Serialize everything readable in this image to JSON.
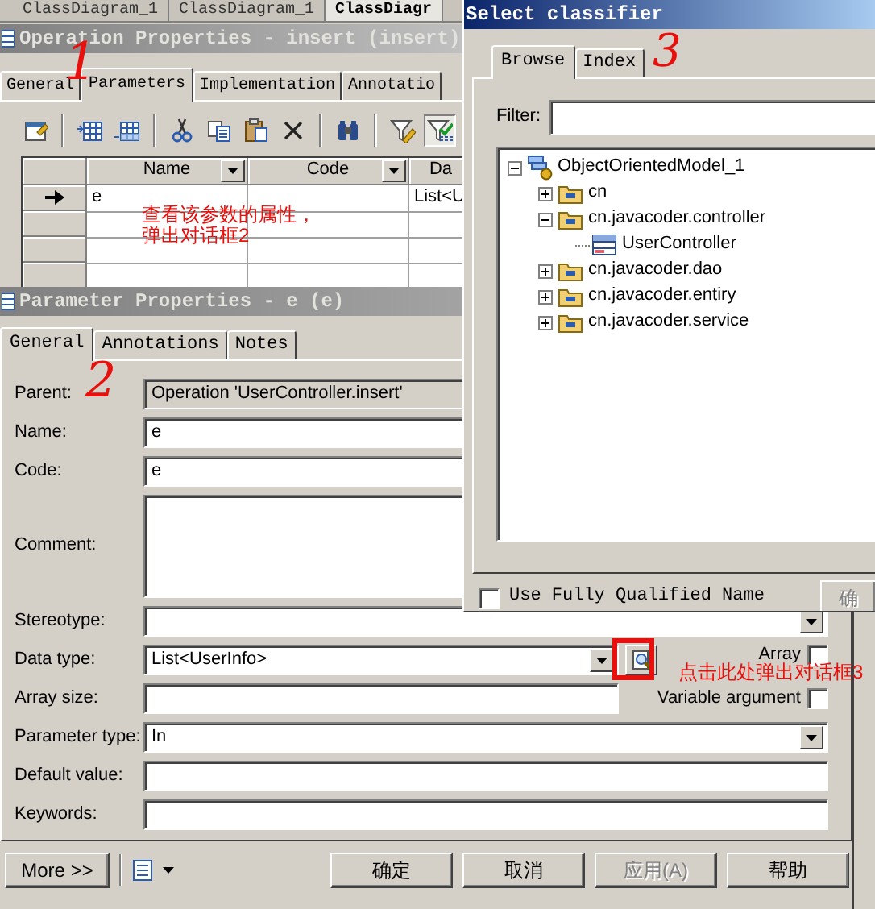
{
  "background_tabs": [
    {
      "label": "ClassDiagram_1",
      "selected": false
    },
    {
      "label": "ClassDiagram_1",
      "selected": false
    },
    {
      "label": "ClassDiagr",
      "selected": true
    }
  ],
  "operation_window": {
    "title": "Operation Properties - insert (insert)",
    "active": false,
    "tabs": [
      {
        "label": "General",
        "selected": false
      },
      {
        "label": "Parameters",
        "selected": true
      },
      {
        "label": "Implementation",
        "selected": false
      },
      {
        "label": "Annotatio",
        "selected": false
      }
    ],
    "toolbar": [
      {
        "kind": "properties",
        "pressed": false
      },
      {
        "kind": "separator"
      },
      {
        "kind": "insert_row",
        "pressed": false
      },
      {
        "kind": "add_row",
        "pressed": false
      },
      {
        "kind": "separator"
      },
      {
        "kind": "cut",
        "pressed": false
      },
      {
        "kind": "copy",
        "pressed": false
      },
      {
        "kind": "paste",
        "pressed": false
      },
      {
        "kind": "delete",
        "pressed": false
      },
      {
        "kind": "separator"
      },
      {
        "kind": "find",
        "pressed": false
      },
      {
        "kind": "separator"
      },
      {
        "kind": "filter_edit",
        "pressed": false
      },
      {
        "kind": "filter_apply",
        "pressed": true
      }
    ],
    "grid": {
      "columns": [
        {
          "label": "Name",
          "filter": true
        },
        {
          "label": "Code",
          "filter": true
        },
        {
          "label": "Da",
          "filter": false
        }
      ],
      "rows": [
        {
          "current": true,
          "name": "e",
          "column_3": "List<U"
        },
        {
          "current": false
        },
        {
          "current": false
        },
        {
          "current": false
        }
      ]
    }
  },
  "parameter_window": {
    "title": "Parameter Properties - e (e)",
    "active": false,
    "tabs": [
      {
        "label": "General",
        "selected": true
      },
      {
        "label": "Annotations",
        "selected": false
      },
      {
        "label": "Notes",
        "selected": false
      }
    ],
    "fields": [
      {
        "label": "Parent:",
        "kind": "readonly",
        "value": "Operation 'UserController.insert'"
      },
      {
        "label": "Name:",
        "kind": "text",
        "value": "e"
      },
      {
        "label": "Code:",
        "kind": "text",
        "value": "e"
      },
      {
        "label": "Comment:",
        "kind": "textarea"
      },
      {
        "label": "Stereotype:",
        "kind": "combo"
      },
      {
        "label": "Data type:",
        "kind": "combo_browse",
        "value": "List<UserInfo>",
        "checkbox": {
          "label": "Array",
          "checked": false
        }
      },
      {
        "label": "Array size:",
        "kind": "text",
        "checkbox": {
          "label": "Variable argument",
          "checked": false
        }
      },
      {
        "label": "Parameter type:",
        "kind": "combo",
        "value": "In"
      },
      {
        "label": "Default value:",
        "kind": "text"
      },
      {
        "label": "Keywords:",
        "kind": "text"
      }
    ],
    "buttons": [
      {
        "kind": "button",
        "label": "More >>",
        "disabled": false
      },
      {
        "kind": "menu"
      },
      {
        "kind": "button",
        "label": "确定",
        "disabled": false
      },
      {
        "kind": "button",
        "label": "取消",
        "disabled": false
      },
      {
        "kind": "button",
        "label": "应用(A)",
        "disabled": true
      },
      {
        "kind": "button",
        "label": "帮助",
        "disabled": false
      }
    ]
  },
  "select_window": {
    "title": "Select classifier",
    "active": true,
    "tabs": [
      {
        "label": "Browse",
        "selected": true
      },
      {
        "label": "Index",
        "selected": false
      }
    ],
    "filter": {
      "label": "Filter:"
    },
    "tree": [
      {
        "label": "ObjectOrientedModel_1",
        "kind": "model",
        "expanded": true,
        "children": [
          {
            "label": "cn",
            "kind": "package",
            "expanded": false
          },
          {
            "label": "cn.javacoder.controller",
            "kind": "package",
            "expanded": true,
            "children": [
              {
                "label": "UserController",
                "kind": "class"
              }
            ]
          },
          {
            "label": "cn.javacoder.dao",
            "kind": "package",
            "expanded": false
          },
          {
            "label": "cn.javacoder.entiry",
            "kind": "package",
            "expanded": false
          },
          {
            "label": "cn.javacoder.service",
            "kind": "package",
            "expanded": false
          }
        ]
      }
    ],
    "qualified": {
      "label": "Use Fully Qualified Name",
      "checked": false
    },
    "button": {
      "label": "确",
      "disabled": true
    }
  },
  "annotations": [
    {
      "kind": "numeral",
      "text": "1"
    },
    {
      "kind": "numeral",
      "text": "2"
    },
    {
      "kind": "numeral",
      "text": "3"
    },
    {
      "kind": "note",
      "text": "查看该参数的属性，弹出对话框2"
    },
    {
      "kind": "frame"
    },
    {
      "kind": "note",
      "text": "点击此处弹出对话框3"
    }
  ]
}
